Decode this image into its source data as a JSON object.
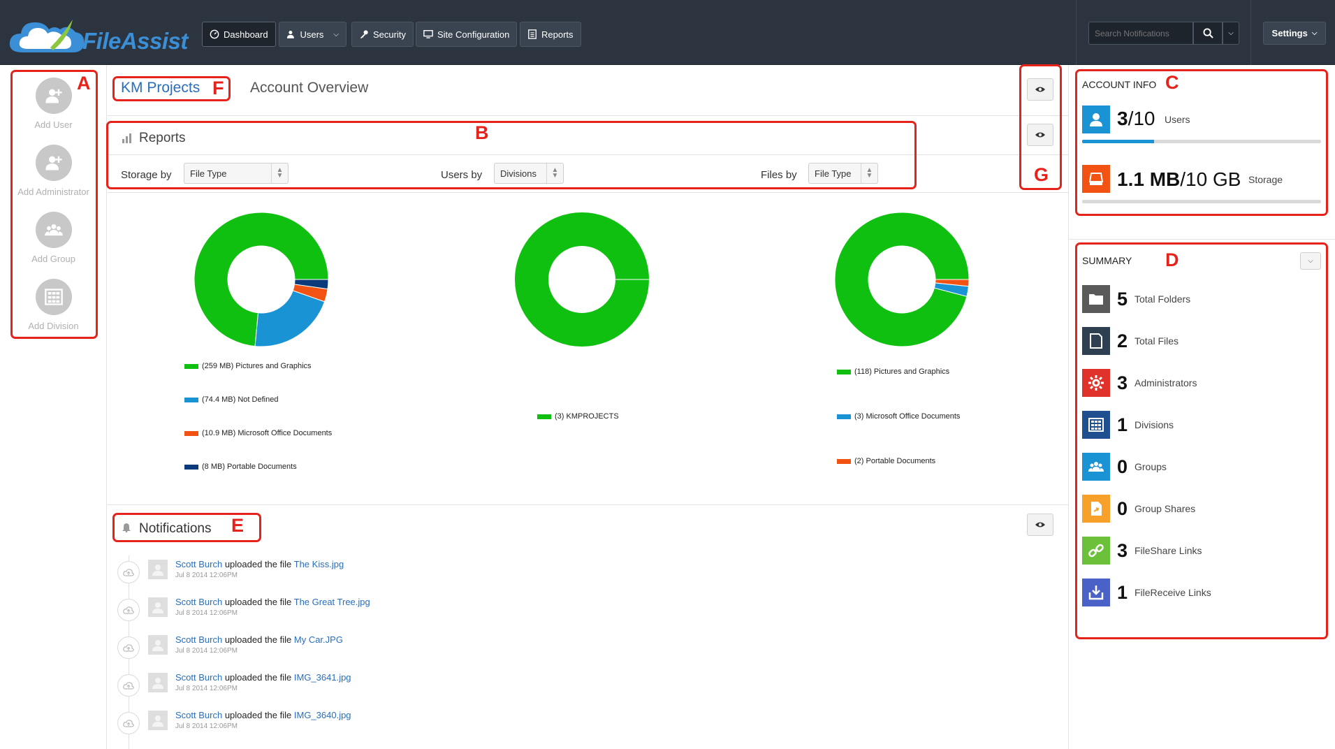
{
  "app": {
    "name": "FileAssist"
  },
  "nav": {
    "items": [
      {
        "label": "Dashboard",
        "icon": "dashboard-icon"
      },
      {
        "label": "Users",
        "icon": "users-icon"
      },
      {
        "label": "Security",
        "icon": "key-icon"
      },
      {
        "label": "Site Configuration",
        "icon": "monitor-icon"
      },
      {
        "label": "Reports",
        "icon": "report-icon"
      }
    ],
    "search_placeholder": "Search Notifications",
    "settings_label": "Settings"
  },
  "quick_actions": [
    {
      "label": "Add User"
    },
    {
      "label": "Add Administrator"
    },
    {
      "label": "Add Group"
    },
    {
      "label": "Add Division"
    }
  ],
  "annotations": [
    "A",
    "B",
    "C",
    "D",
    "E",
    "F",
    "G"
  ],
  "header": {
    "project": "KM Projects",
    "page": "Account Overview"
  },
  "reports": {
    "title": "Reports",
    "filters": [
      {
        "label": "Storage by",
        "value": "File Type"
      },
      {
        "label": "Users by",
        "value": "Divisions"
      },
      {
        "label": "Files by",
        "value": "File Type"
      }
    ]
  },
  "chart_data": [
    {
      "type": "pie",
      "categories": [
        "Pictures and Graphics",
        "Not Defined",
        "Microsoft Office Documents",
        "Portable Documents"
      ],
      "values": [
        259,
        74.4,
        10.9,
        8
      ],
      "unit": "MB",
      "legend": [
        "(259 MB) Pictures and Graphics",
        "(74.4 MB) Not Defined",
        "(10.9 MB) Microsoft Office Documents",
        "(8 MB) Portable Documents"
      ],
      "colors": [
        "#10c010",
        "#1a93d5",
        "#f25312",
        "#0a3a7a"
      ]
    },
    {
      "type": "pie",
      "categories": [
        "KMPROJECTS"
      ],
      "values": [
        3
      ],
      "legend": [
        "(3) KMPROJECTS"
      ],
      "colors": [
        "#10c010"
      ]
    },
    {
      "type": "pie",
      "categories": [
        "Pictures and Graphics",
        "Microsoft Office Documents",
        "Portable Documents"
      ],
      "values": [
        118,
        3,
        2
      ],
      "legend": [
        "(118) Pictures and Graphics",
        "(3) Microsoft Office Documents",
        "(2) Portable Documents"
      ],
      "colors": [
        "#10c010",
        "#1a93d5",
        "#f25312"
      ]
    }
  ],
  "notifications": {
    "title": "Notifications",
    "items": [
      {
        "user": "Scott Burch",
        "action": "uploaded the file",
        "file": "The Kiss.jpg",
        "time": "Jul 8 2014 12:06PM"
      },
      {
        "user": "Scott Burch",
        "action": "uploaded the file",
        "file": "The Great Tree.jpg",
        "time": "Jul 8 2014 12:06PM"
      },
      {
        "user": "Scott Burch",
        "action": "uploaded the file",
        "file": "My Car.JPG",
        "time": "Jul 8 2014 12:06PM"
      },
      {
        "user": "Scott Burch",
        "action": "uploaded the file",
        "file": "IMG_3641.jpg",
        "time": "Jul 8 2014 12:06PM"
      },
      {
        "user": "Scott Burch",
        "action": "uploaded the file",
        "file": "IMG_3640.jpg",
        "time": "Jul 8 2014 12:06PM"
      }
    ]
  },
  "account_info": {
    "title": "ACCOUNT INFO",
    "users": {
      "used": "3",
      "total": "/10",
      "label": "Users",
      "fraction": 0.3
    },
    "storage": {
      "used": "1.1 MB",
      "total": "/10 GB",
      "label": "Storage",
      "fraction": 0.0001
    }
  },
  "summary": {
    "title": "SUMMARY",
    "items": [
      {
        "count": "5",
        "label": "Total Folders",
        "color": "#5a5a5a"
      },
      {
        "count": "2",
        "label": "Total Files",
        "color": "#2f3f52"
      },
      {
        "count": "3",
        "label": "Administrators",
        "color": "#e0312a"
      },
      {
        "count": "1",
        "label": "Divisions",
        "color": "#1f4f8f"
      },
      {
        "count": "0",
        "label": "Groups",
        "color": "#1a93d5"
      },
      {
        "count": "0",
        "label": "Group Shares",
        "color": "#f7a02a"
      },
      {
        "count": "3",
        "label": "FileShare Links",
        "color": "#6cc13a"
      },
      {
        "count": "1",
        "label": "FileReceive Links",
        "color": "#4a62c7"
      }
    ]
  }
}
